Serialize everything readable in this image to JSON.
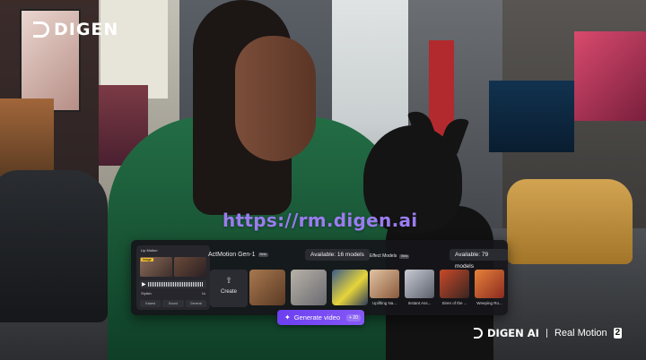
{
  "brand": {
    "name": "DIGEN"
  },
  "url": "https://rm.digen.ai",
  "panel": {
    "lipsync": {
      "title": "Lip Motion",
      "chip": "Image",
      "voice_label": "Stylish",
      "voice_value": "1s",
      "buttons": [
        "Easest",
        "Sound",
        "Generat"
      ]
    },
    "actmotion": {
      "title": "ActMotion Gen-1",
      "badge": "Beta",
      "available": "Available: 16 models",
      "create_label": "Create"
    },
    "effects": {
      "title": "Effect Models",
      "badge": "Beta",
      "available": "Available: 79 models",
      "items": [
        {
          "label": "Uplifting Na..."
        },
        {
          "label": "Instant Ass..."
        },
        {
          "label": "Siren of the ..."
        },
        {
          "label": "Weeping Ro..."
        }
      ]
    },
    "generate": {
      "label": "Generate video",
      "cost": "+ 20"
    }
  },
  "footer": {
    "brand": "DIGEN AI",
    "product": "Real Motion",
    "version": "2"
  }
}
